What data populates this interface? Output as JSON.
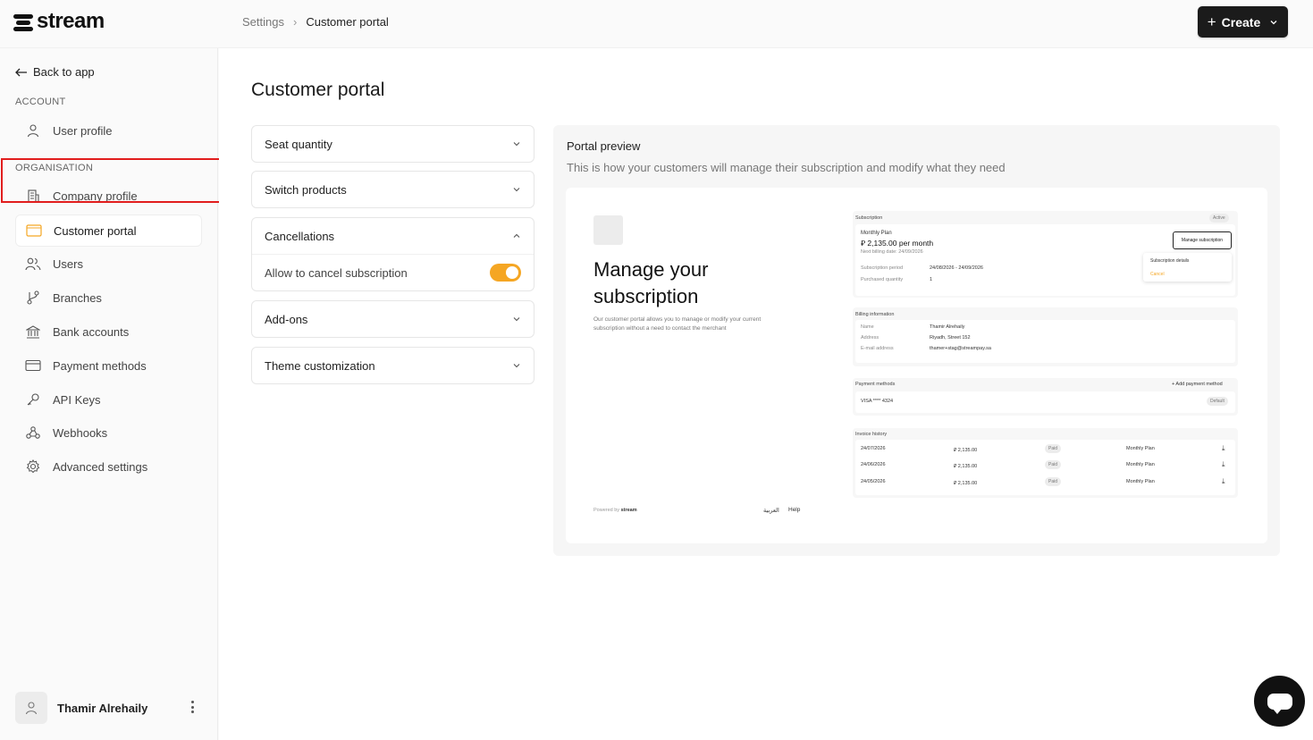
{
  "brand": {
    "name": "stream"
  },
  "breadcrumb": {
    "parent": "Settings",
    "separator": "›",
    "current": "Customer portal"
  },
  "header": {
    "create_label": "Create"
  },
  "sidebar": {
    "back_label": "Back to app",
    "account_label": "ACCOUNT",
    "organisation_label": "ORGANISATION",
    "items": [
      {
        "label": "User profile",
        "icon": "user-icon"
      },
      {
        "label": "Company profile",
        "icon": "building-icon"
      },
      {
        "label": "Customer portal",
        "icon": "window-icon",
        "active": true
      },
      {
        "label": "Users",
        "icon": "users-icon"
      },
      {
        "label": "Branches",
        "icon": "branch-icon"
      },
      {
        "label": "Bank accounts",
        "icon": "bank-icon"
      },
      {
        "label": "Payment methods",
        "icon": "credit-card-icon"
      },
      {
        "label": "API Keys",
        "icon": "key-icon"
      },
      {
        "label": "Webhooks",
        "icon": "webhook-icon"
      },
      {
        "label": "Advanced settings",
        "icon": "gear-icon"
      }
    ],
    "user_name": "Thamir Alrehaily"
  },
  "main": {
    "title": "Customer portal",
    "sections": [
      {
        "label": "Seat quantity",
        "expanded": false
      },
      {
        "label": "Switch products",
        "expanded": false
      },
      {
        "label": "Cancellations",
        "expanded": true,
        "option_label": "Allow to cancel subscription",
        "option_on": true
      },
      {
        "label": "Add-ons",
        "expanded": false
      },
      {
        "label": "Theme customization",
        "expanded": false
      }
    ]
  },
  "preview": {
    "title": "Portal preview",
    "subtitle": "This is how your customers will manage their subscription and modify what they need",
    "heading": "Manage your subscription",
    "description": "Our customer portal allows you to manage or modify your current subscription without a need to contact the merchant",
    "powered_by": "Powered by",
    "powered_brand": "stream",
    "lang": "العربية",
    "help": "Help",
    "subscription": {
      "label": "Subscription",
      "status": "Active",
      "plan": "Monthly Plan",
      "price": "⃁ 2,135.00 per month",
      "next_billing": "Next billing date: 24/09/2026",
      "manage_label": "Manage subscription",
      "menu_details": "Subscription details",
      "menu_cancel": "Cancel",
      "period_label": "Subscription period",
      "period_value": "24/08/2026 - 24/09/2026",
      "qty_label": "Purchased quantity",
      "qty_value": "1"
    },
    "billing": {
      "label": "Billing information",
      "name_label": "Name",
      "name_value": "Thamir Alrehaily",
      "address_label": "Address",
      "address_value": "Riyadh, Street 152",
      "email_label": "E-mail address",
      "email_value": "thamer+stag@streampay.sa"
    },
    "payment": {
      "label": "Payment methods",
      "add_label": "+ Add payment method",
      "card": "VISA **** 4324",
      "default_label": "Default"
    },
    "invoices": {
      "label": "Invoice history",
      "rows": [
        {
          "date": "24/07/2026",
          "amount": "⃁ 2,135.00",
          "status": "Paid",
          "plan": "Monthly Plan"
        },
        {
          "date": "24/06/2026",
          "amount": "⃁ 2,135.00",
          "status": "Paid",
          "plan": "Monthly Plan"
        },
        {
          "date": "24/05/2026",
          "amount": "⃁ 2,135.00",
          "status": "Paid",
          "plan": "Monthly Plan"
        }
      ]
    }
  },
  "colors": {
    "accent": "#f5a623",
    "highlight": "#e11d1d",
    "primary": "#1b1b1b"
  }
}
